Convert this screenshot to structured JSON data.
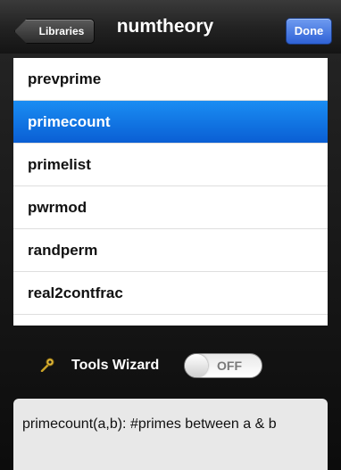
{
  "navbar": {
    "back_label": "Libraries",
    "title": "numtheory",
    "done_label": "Done"
  },
  "functions": [
    {
      "name": "prevprime",
      "selected": false
    },
    {
      "name": "primecount",
      "selected": true
    },
    {
      "name": "primelist",
      "selected": false
    },
    {
      "name": "pwrmod",
      "selected": false
    },
    {
      "name": "randperm",
      "selected": false
    },
    {
      "name": "real2contfrac",
      "selected": false
    }
  ],
  "wizard": {
    "icon": "wand-icon",
    "label": "Tools Wizard",
    "toggle_state": "OFF"
  },
  "description": "primecount(a,b): #primes between a & b",
  "colors": {
    "selected_row": "#0a5fd4",
    "done_button": "#2f62d6"
  }
}
